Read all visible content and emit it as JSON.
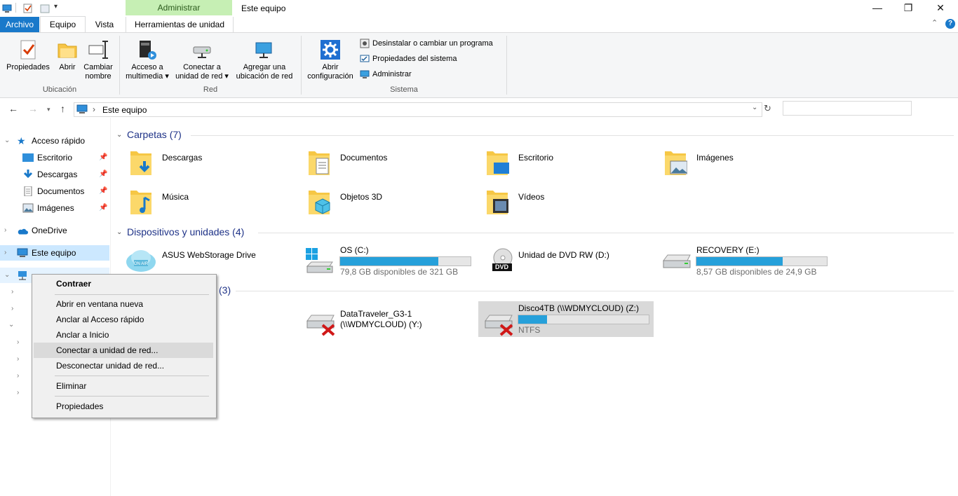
{
  "window": {
    "title": "Este equipo",
    "context_tab_header": "Administrar",
    "minimize": "—",
    "maximize": "❐",
    "close": "✕"
  },
  "tabs": {
    "file": "Archivo",
    "equipo": "Equipo",
    "vista": "Vista",
    "herramientas": "Herramientas de unidad"
  },
  "ribbon": {
    "ubicacion": {
      "label": "Ubicación",
      "propiedades": "Propiedades",
      "abrir": "Abrir",
      "cambiar_1": "Cambiar",
      "cambiar_2": "nombre"
    },
    "red": {
      "label": "Red",
      "acceso_1": "Acceso a",
      "acceso_2": "multimedia ▾",
      "conectar_1": "Conectar a",
      "conectar_2": "unidad de red ▾",
      "agregar_1": "Agregar una",
      "agregar_2": "ubicación de red"
    },
    "sistema": {
      "label": "Sistema",
      "abrir_1": "Abrir",
      "abrir_2": "configuración",
      "desinstalar": "Desinstalar o cambiar un programa",
      "propiedades_sistema": "Propiedades del sistema",
      "administrar": "Administrar"
    }
  },
  "address": {
    "path": "Este equipo",
    "separator": "›"
  },
  "nav": {
    "quick_access": "Acceso rápido",
    "escritorio": "Escritorio",
    "descargas": "Descargas",
    "documentos": "Documentos",
    "imagenes": "Imágenes",
    "onedrive": "OneDrive",
    "este_equipo": "Este equipo"
  },
  "sections": {
    "carpetas": "Carpetas (7)",
    "dispositivos": "Dispositivos y unidades (4)",
    "network_count": "(3)"
  },
  "folders": [
    "Descargas",
    "Documentos",
    "Escritorio",
    "Imágenes",
    "Música",
    "Objetos 3D",
    "Vídeos"
  ],
  "devices": {
    "asus": "ASUS WebStorage Drive",
    "os_name": "OS (C:)",
    "os_free": "79,8 GB disponibles de 321 GB",
    "os_used": 0.75,
    "dvd": "Unidad de DVD RW (D:)",
    "dvd_badge": "DVD",
    "recovery_name": "RECOVERY (E:)",
    "recovery_free": "8,57 GB disponibles de 24,9 GB",
    "recovery_used": 0.66
  },
  "network": {
    "datatraveler_1": "DataTraveler_G3-1",
    "datatraveler_2": "(\\\\WDMYCLOUD) (Y:)",
    "disco_name": "Disco4TB (\\\\WDMYCLOUD) (Z:)",
    "disco_fs": "NTFS",
    "disco_used": 0.22
  },
  "context_menu": {
    "contraer": "Contraer",
    "abrir_ventana": "Abrir en ventana nueva",
    "anclar_acceso": "Anclar al Acceso rápido",
    "anclar_inicio": "Anclar a Inicio",
    "conectar": "Conectar a unidad de red...",
    "desconectar": "Desconectar unidad de red...",
    "eliminar": "Eliminar",
    "propiedades": "Propiedades"
  },
  "colors": {
    "accent": "#1979ca",
    "context_tab": "#c6efb4",
    "progress": "#26a0da",
    "section_head": "#1e3287"
  }
}
